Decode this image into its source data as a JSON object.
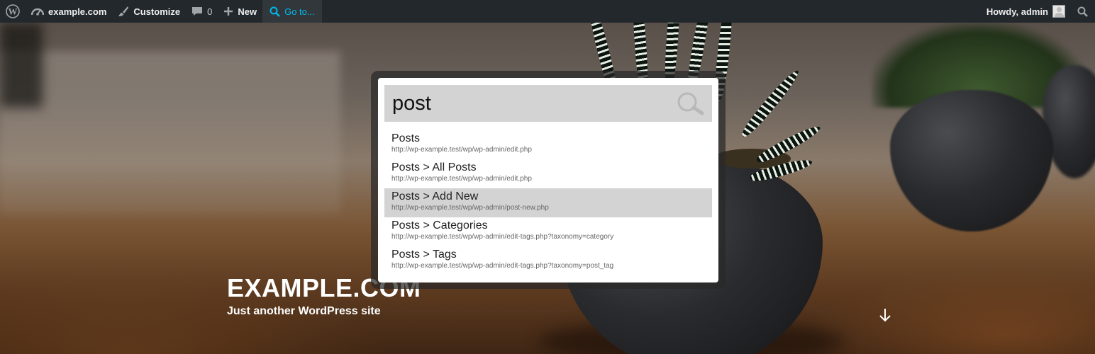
{
  "adminbar": {
    "site_name": "example.com",
    "customize_label": "Customize",
    "comments_count": "0",
    "new_label": "New",
    "goto_label": "Go to...",
    "howdy_label": "Howdy, admin"
  },
  "hero": {
    "site_title": "EXAMPLE.COM",
    "tagline": "Just another WordPress site"
  },
  "goto_modal": {
    "query": "post",
    "selected_index": 2,
    "results": [
      {
        "title": "Posts",
        "url": "http://wp-example.test/wp/wp-admin/edit.php"
      },
      {
        "title": "Posts > All Posts",
        "url": "http://wp-example.test/wp/wp-admin/edit.php"
      },
      {
        "title": "Posts > Add New",
        "url": "http://wp-example.test/wp/wp-admin/post-new.php"
      },
      {
        "title": "Posts > Categories",
        "url": "http://wp-example.test/wp/wp-admin/edit-tags.php?taxonomy=category"
      },
      {
        "title": "Posts > Tags",
        "url": "http://wp-example.test/wp/wp-admin/edit-tags.php?taxonomy=post_tag"
      }
    ]
  },
  "colors": {
    "adminbar_bg": "#23282d",
    "adminbar_text": "#eeeeee",
    "goto_accent": "#00b9eb",
    "search_box_bg": "#d3d3d3",
    "selected_row_bg": "#d3d3d3"
  },
  "icons": {
    "wp_logo": "wordpress-logo-icon",
    "site": "dashboard-gauge-icon",
    "customize": "paintbrush-icon",
    "comments": "speech-bubble-icon",
    "new": "plus-icon",
    "goto": "search-icon",
    "user_search": "search-icon",
    "modal_search": "magnifier-icon",
    "scroll": "arrow-down-icon"
  }
}
